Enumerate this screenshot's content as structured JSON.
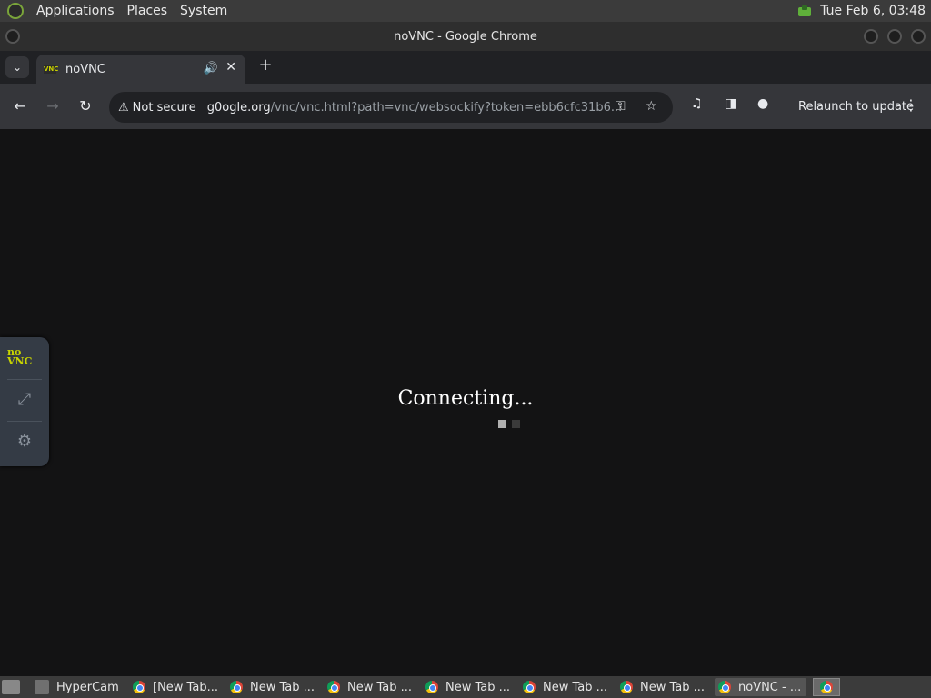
{
  "topbar": {
    "menu": [
      "Applications",
      "Places",
      "System"
    ],
    "clock": "Tue Feb  6, 03:48"
  },
  "window": {
    "title": "noVNC - Google Chrome"
  },
  "tabs": [
    {
      "title": "noVNC",
      "favicon_text": "VNC"
    }
  ],
  "toolbar": {
    "security_label": "Not secure",
    "url_host": "g0ogle.org",
    "url_path": "/vnc/vnc.html?path=vnc/websockify?token=ebb6cfc31b6...",
    "relaunch_label": "Relaunch to update"
  },
  "novnc": {
    "logo_top": "no",
    "logo_bottom": "VNC",
    "status_text": "Connecting..."
  },
  "taskbar": {
    "items": [
      {
        "label": "HyperCam",
        "icon": "hypercam-icon"
      },
      {
        "label": "[New Tab...",
        "icon": "chrome-icon"
      },
      {
        "label": "New Tab ...",
        "icon": "chrome-icon"
      },
      {
        "label": "New Tab ...",
        "icon": "chrome-icon"
      },
      {
        "label": "New Tab ...",
        "icon": "chrome-icon"
      },
      {
        "label": "New Tab ...",
        "icon": "chrome-icon"
      },
      {
        "label": "New Tab ...",
        "icon": "chrome-icon"
      },
      {
        "label": "noVNC - ...",
        "icon": "chrome-icon"
      }
    ]
  }
}
